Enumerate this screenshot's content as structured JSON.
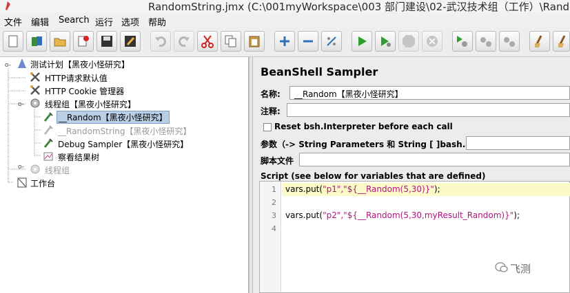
{
  "window": {
    "title": "RandomString.jmx (C:\\001myWorkspace\\003 部门建设\\02-武汉技术组（工作）\\Random"
  },
  "menu": [
    "文件",
    "编辑",
    "Search",
    "运行",
    "选项",
    "帮助"
  ],
  "toolbar": {
    "buttons": [
      "new-icon",
      "templates-icon",
      "open-icon",
      "close-icon",
      "save-icon",
      "save-as-icon",
      "undo-icon",
      "redo-icon",
      "cut-icon",
      "copy-icon",
      "paste-icon",
      "expand-icon",
      "collapse-icon",
      "toggle-icon",
      "start-icon",
      "start-no-pause-icon",
      "stop-icon",
      "shutdown-icon",
      "remote-start-icon",
      "remote-stop-icon",
      "remote-exit-icon",
      "clear-icon",
      "clear-all-icon"
    ]
  },
  "tree": {
    "items": [
      {
        "label": "测试计划【黑夜小怪研究】",
        "icon": "test-plan-icon",
        "disabled": false
      },
      {
        "label": "HTTP请求默认值",
        "icon": "config-icon",
        "disabled": false
      },
      {
        "label": "HTTP Cookie 管理器",
        "icon": "config-icon",
        "disabled": false
      },
      {
        "label": "线程组【黑夜小怪研究】",
        "icon": "thread-group-icon",
        "disabled": false
      },
      {
        "label": "__Random【黑夜小怪研究】",
        "icon": "sampler-icon",
        "disabled": false,
        "selected": true
      },
      {
        "label": "__RandomString【黑夜小怪研究】",
        "icon": "sampler-icon",
        "disabled": true
      },
      {
        "label": "Debug Sampler【黑夜小怪研究】",
        "icon": "sampler-icon",
        "disabled": false
      },
      {
        "label": "察看结果树",
        "icon": "listener-icon",
        "disabled": false
      },
      {
        "label": "线程组",
        "icon": "thread-group-icon",
        "disabled": true
      },
      {
        "label": "工作台",
        "icon": "workbench-icon",
        "disabled": false
      }
    ]
  },
  "panel": {
    "title": "BeanShell Sampler",
    "name_label": "名称:",
    "name_value": "__Random【黑夜小怪研究】",
    "comment_label": "注释:",
    "comment_value": "",
    "reset_label": "Reset bsh.Interpreter before each call",
    "params_label": "参数（-> String Parameters 和 String [ ]bash.args）",
    "params_value": "",
    "script_file_label": "脚本文件",
    "script_file_value": "",
    "script_label": "Script (see below for variables that are defined)"
  },
  "script": {
    "lines": [
      {
        "num": "1",
        "prefix": "vars.put(",
        "strings": "\"p1\",\"${__Random(5,30)}\"",
        "suffix": ");"
      },
      {
        "num": "2",
        "prefix": "",
        "strings": "",
        "suffix": ""
      },
      {
        "num": "3",
        "prefix": "vars.put(",
        "strings": "\"p2\",\"${__Random(5,30,myResult_Random)}\"",
        "suffix": ");"
      },
      {
        "num": "4",
        "prefix": "",
        "strings": "",
        "suffix": ""
      }
    ]
  },
  "watermark": "飞测",
  "colors": {
    "selection": "#b8cfe5",
    "highlight_line": "#fbfac8",
    "string": "#b0147f",
    "run_green": "#2e9e2e"
  }
}
